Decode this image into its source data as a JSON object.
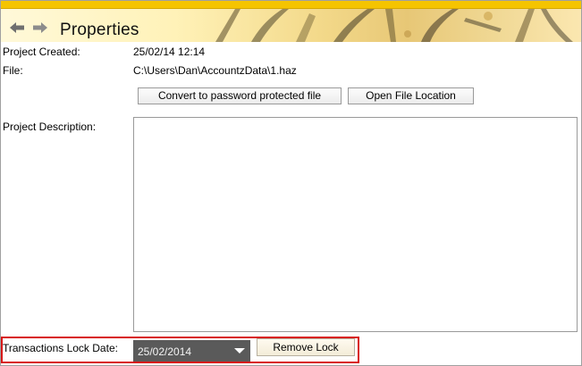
{
  "header": {
    "title": "Properties",
    "back_icon": "arrow-left-icon",
    "forward_icon": "arrow-right-icon"
  },
  "project": {
    "created_label": "Project Created:",
    "created_value": "25/02/14 12:14",
    "file_label": "File:",
    "file_value": "C:\\Users\\Dan\\AccountzData\\1.haz",
    "description_label": "Project Description:",
    "description_value": ""
  },
  "buttons": {
    "convert": "Convert to password protected file",
    "open_location": "Open File Location",
    "remove_lock": "Remove Lock"
  },
  "lock": {
    "label": "Transactions Lock Date:",
    "date": "25/02/2014"
  },
  "colors": {
    "accent": "#f5c400",
    "highlight_border": "#d81818",
    "select_bg": "#5a5a5a"
  }
}
